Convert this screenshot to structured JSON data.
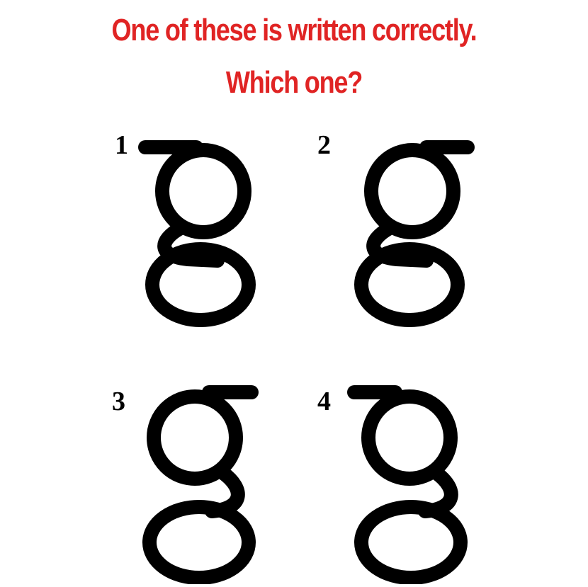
{
  "question": {
    "line1": "One of these is written correctly.",
    "line2": "Which one?"
  },
  "options": [
    {
      "number": "1",
      "variant": "bar-left-crossing"
    },
    {
      "number": "2",
      "variant": "bar-right-detached"
    },
    {
      "number": "3",
      "variant": "bar-right-open-neck"
    },
    {
      "number": "4",
      "variant": "bar-left-open-neck"
    }
  ],
  "colors": {
    "title": "#e02424",
    "glyph": "#000000",
    "background": "#ffffff"
  }
}
